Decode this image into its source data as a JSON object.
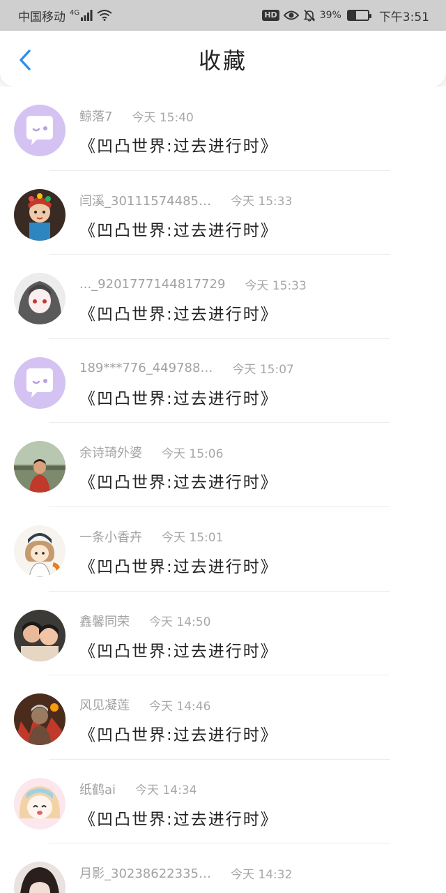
{
  "status_bar": {
    "carrier": "中国移动",
    "network": "4G",
    "hd": "HD",
    "battery_percent": "39%",
    "battery_level": 0.39,
    "time": "下午3:51"
  },
  "header": {
    "title": "收藏",
    "back_icon": "chevron-left-icon",
    "accent_color": "#2f8ff0"
  },
  "items": [
    {
      "name": "鲸落7",
      "time": "今天 15:40",
      "title": "《凹凸世界:过去进行时》",
      "avatar": "default-chat"
    },
    {
      "name": "闫溪_30111574485…",
      "time": "今天 15:33",
      "title": "《凹凸世界:过去进行时》",
      "avatar": "photo-opera"
    },
    {
      "name": "..._9201777144817729",
      "time": "今天 15:33",
      "title": "《凹凸世界:过去进行时》",
      "avatar": "photo-anime-white"
    },
    {
      "name": "189***776_449788…",
      "time": "今天 15:07",
      "title": "《凹凸世界:过去进行时》",
      "avatar": "default-chat"
    },
    {
      "name": "余诗琦外婆",
      "time": "今天 15:06",
      "title": "《凹凸世界:过去进行时》",
      "avatar": "photo-outdoor"
    },
    {
      "name": "一条小香卉",
      "time": "今天 15:01",
      "title": "《凹凸世界:过去进行时》",
      "avatar": "photo-cartoon-girl"
    },
    {
      "name": "鑫馨同荣",
      "time": "今天 14:50",
      "title": "《凹凸世界:过去进行时》",
      "avatar": "photo-kids"
    },
    {
      "name": "风见凝莲",
      "time": "今天 14:46",
      "title": "《凹凸世界:过去进行时》",
      "avatar": "photo-warrior"
    },
    {
      "name": "纸鹤ai",
      "time": "今天 14:34",
      "title": "《凹凸世界:过去进行时》",
      "avatar": "photo-anime-pink"
    },
    {
      "name": "月影_30238622335…",
      "time": "今天 14:32",
      "title": "",
      "avatar": "photo-dark-hair"
    }
  ]
}
